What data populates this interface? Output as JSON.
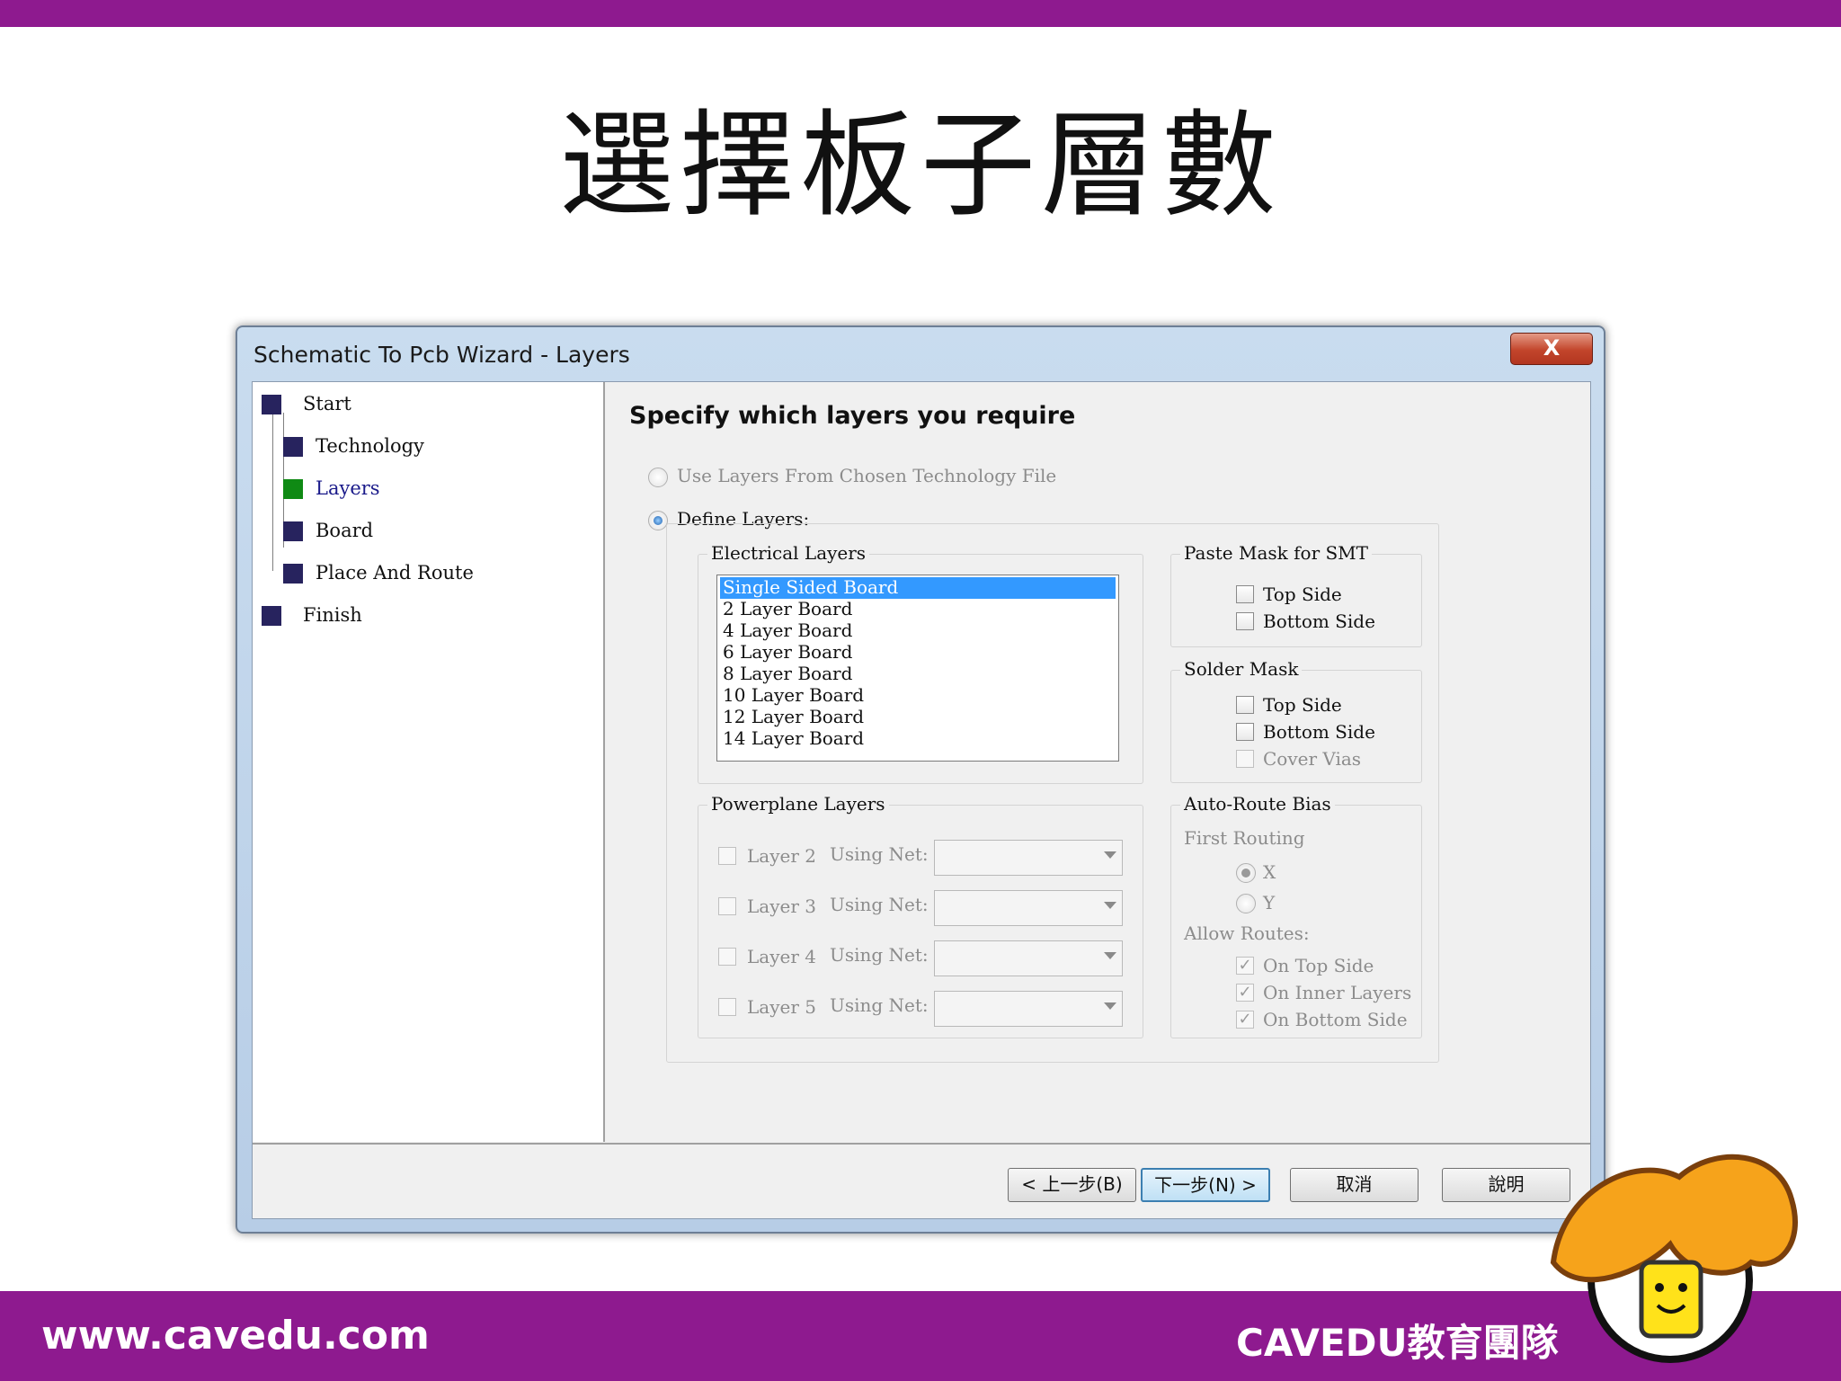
{
  "slide": {
    "title": "選擇板子層數",
    "footer_url": "www.cavedu.com",
    "footer_brand": "CAVEDU教育團隊",
    "brand_color": "#8e1a8f"
  },
  "window": {
    "title": "Schematic To Pcb Wizard - Layers",
    "close_label": "X"
  },
  "nav": {
    "items": [
      {
        "label": "Start",
        "state": "done"
      },
      {
        "label": "Technology",
        "state": "done"
      },
      {
        "label": "Layers",
        "state": "current"
      },
      {
        "label": "Board",
        "state": "done"
      },
      {
        "label": "Place And Route",
        "state": "done"
      },
      {
        "label": "Finish",
        "state": "done"
      }
    ]
  },
  "page": {
    "heading": "Specify which layers you require",
    "radio_tech_file": "Use Layers From Chosen Technology File",
    "radio_define": "Define Layers:"
  },
  "electrical": {
    "title": "Electrical Layers",
    "items": [
      "Single Sided Board",
      "2 Layer Board",
      "4 Layer Board",
      "6 Layer Board",
      "8 Layer Board",
      "10 Layer Board",
      "12 Layer Board",
      "14 Layer Board"
    ],
    "selected": "Single Sided Board"
  },
  "powerplane": {
    "title": "Powerplane Layers",
    "rows": [
      {
        "label": "Layer 2",
        "net_label": "Using Net:"
      },
      {
        "label": "Layer 3",
        "net_label": "Using Net:"
      },
      {
        "label": "Layer 4",
        "net_label": "Using Net:"
      },
      {
        "label": "Layer 5",
        "net_label": "Using Net:"
      }
    ]
  },
  "paste_mask": {
    "title": "Paste Mask for SMT",
    "top": "Top Side",
    "bottom": "Bottom Side"
  },
  "solder_mask": {
    "title": "Solder Mask",
    "top": "Top Side",
    "bottom": "Bottom Side",
    "vias": "Cover Vias"
  },
  "auto_route": {
    "title": "Auto-Route Bias",
    "first_routing": "First Routing",
    "x": "X",
    "y": "Y",
    "allow_routes": "Allow Routes:",
    "on_top": "On Top Side",
    "on_inner": "On Inner Layers",
    "on_bottom": "On Bottom Side"
  },
  "buttons": {
    "back": "< 上一步(B)",
    "next": "下一步(N) >",
    "cancel": "取消",
    "help": "說明"
  }
}
